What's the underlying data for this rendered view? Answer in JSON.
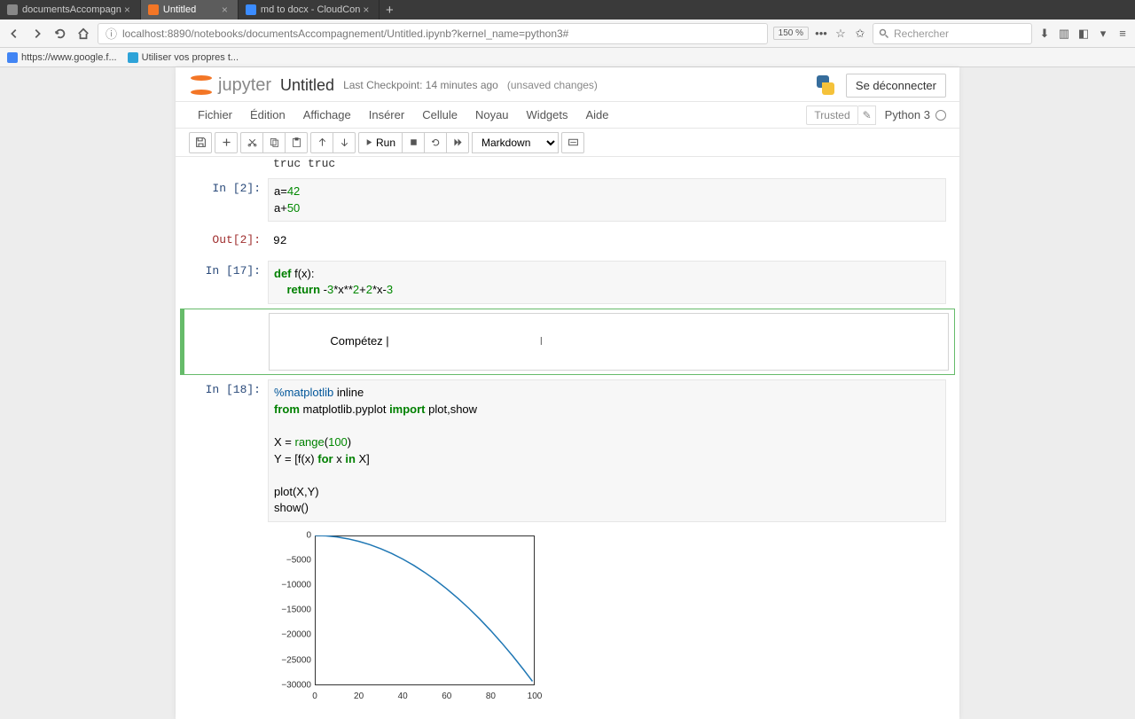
{
  "browser": {
    "tabs": [
      {
        "label": "documentsAccompagn",
        "active": false
      },
      {
        "label": "Untitled",
        "active": true
      },
      {
        "label": "md to docx - CloudCon",
        "active": false
      }
    ],
    "url": "localhost:8890/notebooks/documentsAccompagnement/Untitled.ipynb?kernel_name=python3#",
    "zoom": "150 %",
    "search_placeholder": "Rechercher",
    "bookmarks": [
      {
        "label": "https://www.google.f..."
      },
      {
        "label": "Utiliser vos propres t..."
      }
    ]
  },
  "jupyter": {
    "logo_text": "jupyter",
    "title": "Untitled",
    "checkpoint": "Last Checkpoint: 14 minutes ago",
    "unsaved": "(unsaved changes)",
    "logout": "Se déconnecter",
    "menus": [
      "Fichier",
      "Édition",
      "Affichage",
      "Insérer",
      "Cellule",
      "Noyau",
      "Widgets",
      "Aide"
    ],
    "trusted": "Trusted",
    "kernel": "Python 3",
    "cell_type": "Markdown",
    "run_label": "Run"
  },
  "notebook": {
    "truncated_top": "truc truc",
    "cells": [
      {
        "prompt": "In [2]:",
        "lines": [
          [
            {
              "t": "a=",
              "c": ""
            },
            {
              "t": "42",
              "c": "kw-num"
            }
          ],
          [
            {
              "t": "a+",
              "c": ""
            },
            {
              "t": "50",
              "c": "kw-num"
            }
          ]
        ]
      },
      {
        "prompt": "Out[2]:",
        "out": true,
        "text": "92"
      },
      {
        "prompt": "In [17]:",
        "lines": [
          [
            {
              "t": "def",
              "c": "kw-green"
            },
            {
              "t": " f(x):",
              "c": ""
            }
          ],
          [
            {
              "t": "    ",
              "c": ""
            },
            {
              "t": "return",
              "c": "kw-green"
            },
            {
              "t": " -",
              "c": ""
            },
            {
              "t": "3",
              "c": "kw-num"
            },
            {
              "t": "*x**",
              "c": ""
            },
            {
              "t": "2",
              "c": "kw-num"
            },
            {
              "t": "+",
              "c": ""
            },
            {
              "t": "2",
              "c": "kw-num"
            },
            {
              "t": "*x-",
              "c": ""
            },
            {
              "t": "3",
              "c": "kw-num"
            }
          ]
        ]
      },
      {
        "editing": true,
        "text": "Compétez |"
      },
      {
        "prompt": "In [18]:",
        "lines": [
          [
            {
              "t": "%",
              "c": "kw-mag"
            },
            {
              "t": "matplotlib",
              "c": "kw-mag"
            },
            {
              "t": " inline",
              "c": ""
            }
          ],
          [
            {
              "t": "from",
              "c": "kw-imp"
            },
            {
              "t": " matplotlib.pyplot ",
              "c": ""
            },
            {
              "t": "import",
              "c": "kw-imp"
            },
            {
              "t": " plot,show",
              "c": ""
            }
          ],
          [
            {
              "t": "",
              "c": ""
            }
          ],
          [
            {
              "t": "X = ",
              "c": ""
            },
            {
              "t": "range",
              "c": "kw-builtin"
            },
            {
              "t": "(",
              "c": ""
            },
            {
              "t": "100",
              "c": "kw-num"
            },
            {
              "t": ")",
              "c": ""
            }
          ],
          [
            {
              "t": "Y = [f(x) ",
              "c": ""
            },
            {
              "t": "for",
              "c": "kw-green"
            },
            {
              "t": " x ",
              "c": ""
            },
            {
              "t": "in",
              "c": "kw-green"
            },
            {
              "t": " X]",
              "c": ""
            }
          ],
          [
            {
              "t": "",
              "c": ""
            }
          ],
          [
            {
              "t": "plot(X,Y)",
              "c": ""
            }
          ],
          [
            {
              "t": "show()",
              "c": ""
            }
          ]
        ]
      }
    ]
  },
  "chart_data": {
    "type": "line",
    "title": "",
    "xlabel": "",
    "ylabel": "",
    "xlim": [
      0,
      100
    ],
    "ylim": [
      -30000,
      0
    ],
    "xticks": [
      0,
      20,
      40,
      60,
      80,
      100
    ],
    "yticks": [
      0,
      -5000,
      -10000,
      -15000,
      -20000,
      -25000,
      -30000
    ],
    "x": [
      0,
      5,
      10,
      15,
      20,
      25,
      30,
      35,
      40,
      45,
      50,
      55,
      60,
      65,
      70,
      75,
      80,
      85,
      90,
      95,
      99
    ],
    "y": [
      -3,
      -68,
      -283,
      -648,
      -1163,
      -1828,
      -2643,
      -3608,
      -4723,
      -5988,
      -7403,
      -8968,
      -10683,
      -12548,
      -14563,
      -16728,
      -19043,
      -21508,
      -24123,
      -26888,
      -29208
    ]
  }
}
